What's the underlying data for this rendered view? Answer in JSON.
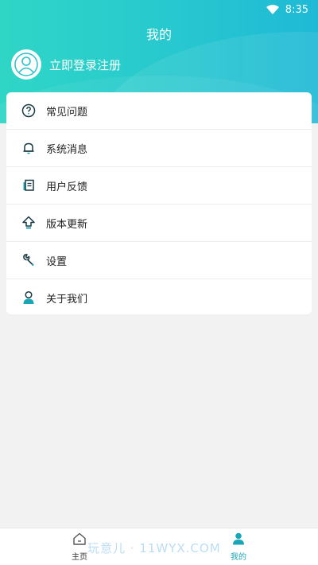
{
  "status_bar": {
    "time": "8:35",
    "wifi_icon": "wifi-icon"
  },
  "header": {
    "title": "我的",
    "login_text": "立即登录注册",
    "avatar_icon": "user-avatar-icon"
  },
  "menu": {
    "items": [
      {
        "label": "常见问题",
        "icon": "question-icon"
      },
      {
        "label": "系统消息",
        "icon": "bell-icon"
      },
      {
        "label": "用户反馈",
        "icon": "feedback-icon"
      },
      {
        "label": "版本更新",
        "icon": "upgrade-icon"
      },
      {
        "label": "设置",
        "icon": "wrench-icon"
      },
      {
        "label": "关于我们",
        "icon": "person-icon"
      }
    ]
  },
  "bottom_nav": {
    "tabs": [
      {
        "label": "主页",
        "icon": "home-icon",
        "active": false
      },
      {
        "label": "我的",
        "icon": "user-icon",
        "active": true
      }
    ]
  },
  "watermark": "玩意儿 · 11WYX.COM",
  "colors": {
    "header_gradient_start": "#2fd6c6",
    "header_gradient_end": "#1fb9d6",
    "active_tab": "#1aa6b7",
    "icon_teal": "#1aa6b7"
  }
}
